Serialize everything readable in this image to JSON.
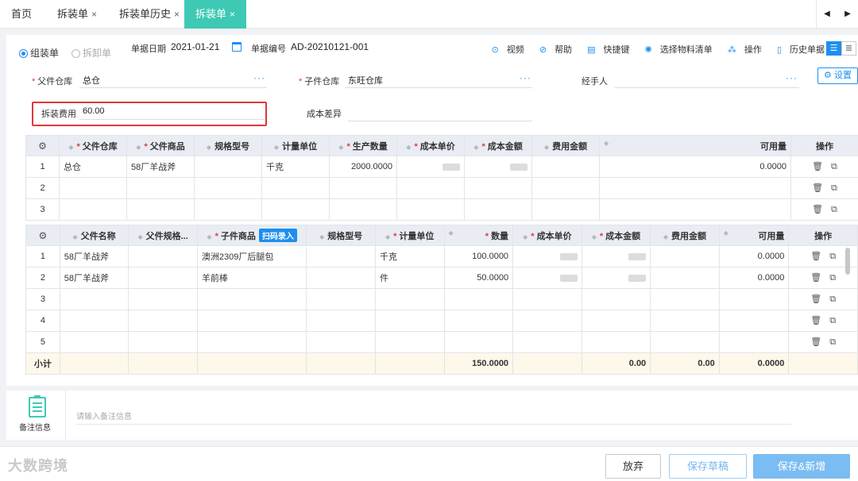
{
  "tabs": [
    {
      "label": "首页",
      "closable": false
    },
    {
      "label": "拆装单",
      "closable": true
    },
    {
      "label": "拆装单历史",
      "closable": true
    },
    {
      "label": "拆装单",
      "closable": true,
      "active": true
    }
  ],
  "tab_close": "×",
  "nav": {
    "prev": "◀",
    "next": "▶"
  },
  "mode": {
    "assemble": "组装单",
    "disassemble": "拆卸单"
  },
  "doc": {
    "date_label": "单据日期",
    "date_value": "2021-01-21",
    "no_label": "单据编号",
    "no_value": "AD-20210121-001"
  },
  "tools": {
    "video": "视频",
    "help": "帮助",
    "shortcut": "快捷键",
    "select_material": "选择物料清单",
    "operation": "操作",
    "history": "历史单据"
  },
  "form": {
    "parent_wh_label": "父件仓库",
    "parent_wh_value": "总仓",
    "child_wh_label": "子件仓库",
    "child_wh_value": "东旺仓库",
    "handler_label": "经手人",
    "handler_value": "",
    "settings_label": "设置",
    "fee_label": "拆装费用",
    "fee_value": "60.00",
    "cost_diff_label": "成本差异",
    "more": "···"
  },
  "parent_table": {
    "headers": [
      "父件仓库",
      "父件商品",
      "规格型号",
      "计量单位",
      "生产数量",
      "成本单价",
      "成本金额",
      "费用金额",
      "可用量",
      "操作"
    ],
    "rows": [
      {
        "idx": "1",
        "warehouse": "总仓",
        "product": "58厂羊战斧",
        "spec": "",
        "unit": "千克",
        "qty": "2000.0000",
        "available": "0.0000"
      },
      {
        "idx": "2",
        "warehouse": "",
        "product": "",
        "spec": "",
        "unit": "",
        "qty": "",
        "available": ""
      },
      {
        "idx": "3",
        "warehouse": "",
        "product": "",
        "spec": "",
        "unit": "",
        "qty": "",
        "available": ""
      }
    ]
  },
  "child_table": {
    "headers": [
      "父件名称",
      "父件规格...",
      "子件商品",
      "规格型号",
      "计量单位",
      "数量",
      "成本单价",
      "成本金额",
      "费用金额",
      "可用量",
      "操作"
    ],
    "scan_label": "扫码录入",
    "rows": [
      {
        "idx": "1",
        "parent_name": "58厂羊战斧",
        "product": "澳洲2309厂后腿包",
        "unit": "千克",
        "qty": "100.0000",
        "available": "0.0000"
      },
      {
        "idx": "2",
        "parent_name": "58厂羊战斧",
        "product": "羊前棒",
        "unit": "件",
        "qty": "50.0000",
        "available": "0.0000"
      },
      {
        "idx": "3",
        "parent_name": "",
        "product": "",
        "unit": "",
        "qty": "",
        "available": ""
      },
      {
        "idx": "4",
        "parent_name": "",
        "product": "",
        "unit": "",
        "qty": "",
        "available": ""
      },
      {
        "idx": "5",
        "parent_name": "",
        "product": "",
        "unit": "",
        "qty": "",
        "available": ""
      }
    ],
    "subtotal": {
      "label": "小计",
      "qty": "150.0000",
      "cost_amount": "0.00",
      "fee_amount": "0.00",
      "available": "0.0000"
    }
  },
  "remarks": {
    "label": "备注信息",
    "placeholder": "请输入备注信息"
  },
  "footer": {
    "logo": "大数跨境",
    "discard": "放弃",
    "save_draft": "保存草稿",
    "save_new": "保存&新增"
  },
  "colors": {
    "accent": "#3ec9b4",
    "primary": "#1d8ef0",
    "danger": "#e03838"
  }
}
